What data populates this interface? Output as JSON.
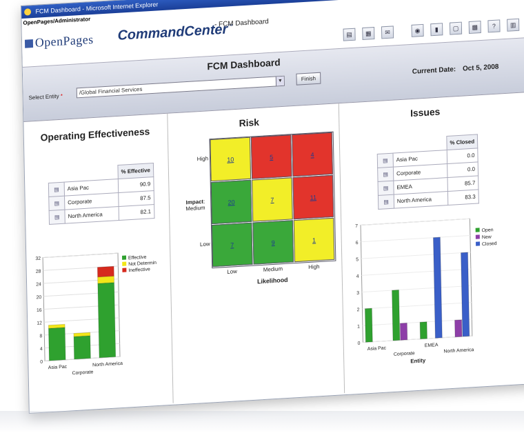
{
  "window": {
    "title": "FCM Dashboard - Microsoft Internet Explorer",
    "controls": [
      "_",
      "□",
      "×"
    ]
  },
  "user_path": "OpenPages/Administrator",
  "brand": {
    "logo": "OpenPages",
    "product": "CommandCenter",
    "tm": "™",
    "breadcrumb": "- FCM Dashboard"
  },
  "toolbar": {
    "icons": [
      "save-icon",
      "print-icon",
      "email-icon",
      "refresh-icon",
      "bookmark-icon",
      "view-icon",
      "grid-icon",
      "help-icon",
      "settings-icon",
      "window-icon"
    ]
  },
  "page": {
    "title": "FCM Dashboard",
    "select_entity_label": "Select Entity",
    "required_mark": "*",
    "entity_value": "/Global Financial Services",
    "finish_label": "Finish",
    "current_date_label": "Current Date:",
    "current_date": "Oct 5, 2008"
  },
  "operating_effectiveness": {
    "title": "Operating Effectiveness",
    "table_header": "% Effective",
    "rows": [
      {
        "label": "Asia Pac",
        "value": "90.9"
      },
      {
        "label": "Corporate",
        "value": "87.5"
      },
      {
        "label": "North America",
        "value": "82.1"
      }
    ]
  },
  "risk": {
    "title": "Risk",
    "y_title": "Impact",
    "y_labels": [
      "High",
      "Medium",
      "Low"
    ],
    "x_labels": [
      "Low",
      "Medium",
      "High"
    ],
    "x_title": "Likelihood",
    "cells": [
      [
        {
          "value": "10",
          "color": "yellow"
        },
        {
          "value": "5",
          "color": "red"
        },
        {
          "value": "4",
          "color": "red"
        }
      ],
      [
        {
          "value": "20",
          "color": "green"
        },
        {
          "value": "7",
          "color": "yellow"
        },
        {
          "value": "11",
          "color": "red"
        }
      ],
      [
        {
          "value": "7",
          "color": "green"
        },
        {
          "value": "9",
          "color": "green"
        },
        {
          "value": "1",
          "color": "yellow"
        }
      ]
    ],
    "colors": {
      "green": "#3aa83a",
      "yellow": "#f2ee28",
      "red": "#e2342c"
    }
  },
  "issues": {
    "title": "Issues",
    "table_header": "% Closed",
    "rows": [
      {
        "label": "Asia Pac",
        "value": "0.0"
      },
      {
        "label": "Corporate",
        "value": "0.0"
      },
      {
        "label": "EMEA",
        "value": "85.7"
      },
      {
        "label": "North America",
        "value": "83.3"
      }
    ]
  },
  "chart_data": [
    {
      "type": "bar",
      "stacked": true,
      "categories": [
        "Asia Pac",
        "Corporate",
        "North America"
      ],
      "series": [
        {
          "name": "Effective",
          "values": [
            10,
            7,
            23
          ],
          "color": "#2fa12f"
        },
        {
          "name": "Not Determin",
          "values": [
            1,
            1,
            2
          ],
          "color": "#f2e619"
        },
        {
          "name": "Ineffective",
          "values": [
            0,
            0,
            3
          ],
          "color": "#d62a1e"
        }
      ],
      "ylim": [
        0,
        32
      ],
      "yticks": [
        0,
        4,
        8,
        12,
        16,
        20,
        24,
        28,
        32
      ],
      "legend": "right"
    },
    {
      "type": "bar",
      "categories": [
        "Asia Pac",
        "Corporate",
        "EMEA",
        "North America"
      ],
      "series": [
        {
          "name": "Open",
          "values": [
            2,
            3,
            1,
            0
          ],
          "color": "#2fa12f"
        },
        {
          "name": "New",
          "values": [
            0,
            1,
            0,
            1
          ],
          "color": "#8e3fa8"
        },
        {
          "name": "Closed",
          "values": [
            0,
            0,
            6,
            5
          ],
          "color": "#3a5fc8"
        }
      ],
      "ylim": [
        0,
        7
      ],
      "yticks": [
        0,
        1,
        2,
        3,
        4,
        5,
        6,
        7
      ],
      "xlabel": "Entity",
      "legend": "right"
    }
  ]
}
